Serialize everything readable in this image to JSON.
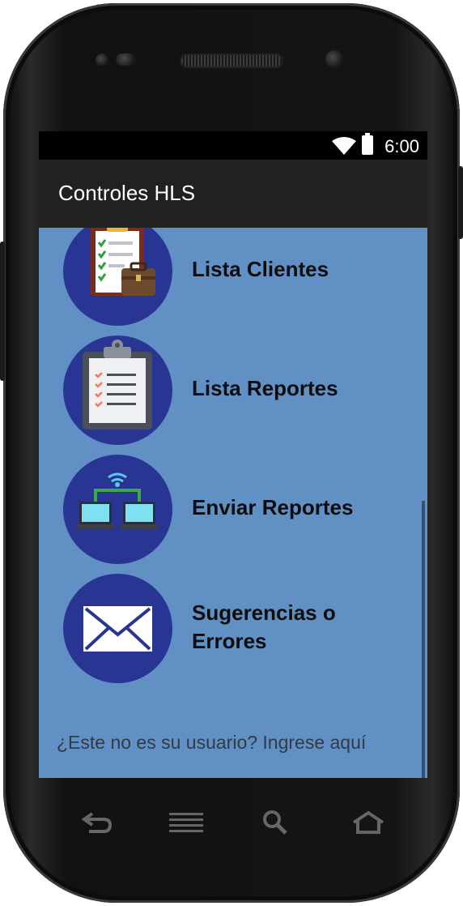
{
  "status_bar": {
    "time": "6:00"
  },
  "app_bar": {
    "title": "Controles HLS"
  },
  "menu": [
    {
      "label": "Lista Clientes",
      "icon": "clipboard-briefcase-icon"
    },
    {
      "label": "Lista Reportes",
      "icon": "clipboard-list-icon"
    },
    {
      "label": "Enviar Reportes",
      "icon": "network-computers-icon"
    },
    {
      "label_line1": "Sugerencias o",
      "label_line2": "Errores",
      "icon": "envelope-icon"
    }
  ],
  "footer": {
    "link": "¿Este no es su usuario? Ingrese aquí"
  },
  "nav_bar": {
    "buttons": [
      "back-icon",
      "menu-icon",
      "search-icon",
      "home-icon"
    ]
  },
  "colors": {
    "content_bg": "#6190c4",
    "app_bar": "#212121",
    "icon_circle": "#283593"
  }
}
